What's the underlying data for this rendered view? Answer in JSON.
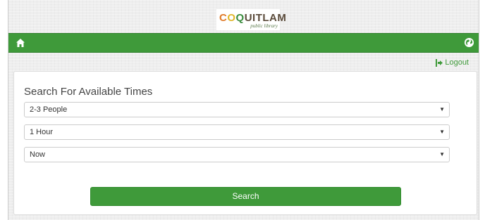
{
  "header": {
    "logo_prefix1": "C",
    "logo_prefix2": "O",
    "logo_prefix3": "Q",
    "logo_rest": "UITLAM",
    "logo_tagline": "public library"
  },
  "navbar": {
    "home_icon": "home-icon",
    "globe_icon": "globe-icon",
    "color": "#3f9a3a"
  },
  "account": {
    "logout_label": "Logout",
    "logout_icon": "logout-icon"
  },
  "search_form": {
    "title": "Search For Available Times",
    "group_size": "2-3 People",
    "duration": "1 Hour",
    "start_time": "Now",
    "submit_label": "Search"
  }
}
